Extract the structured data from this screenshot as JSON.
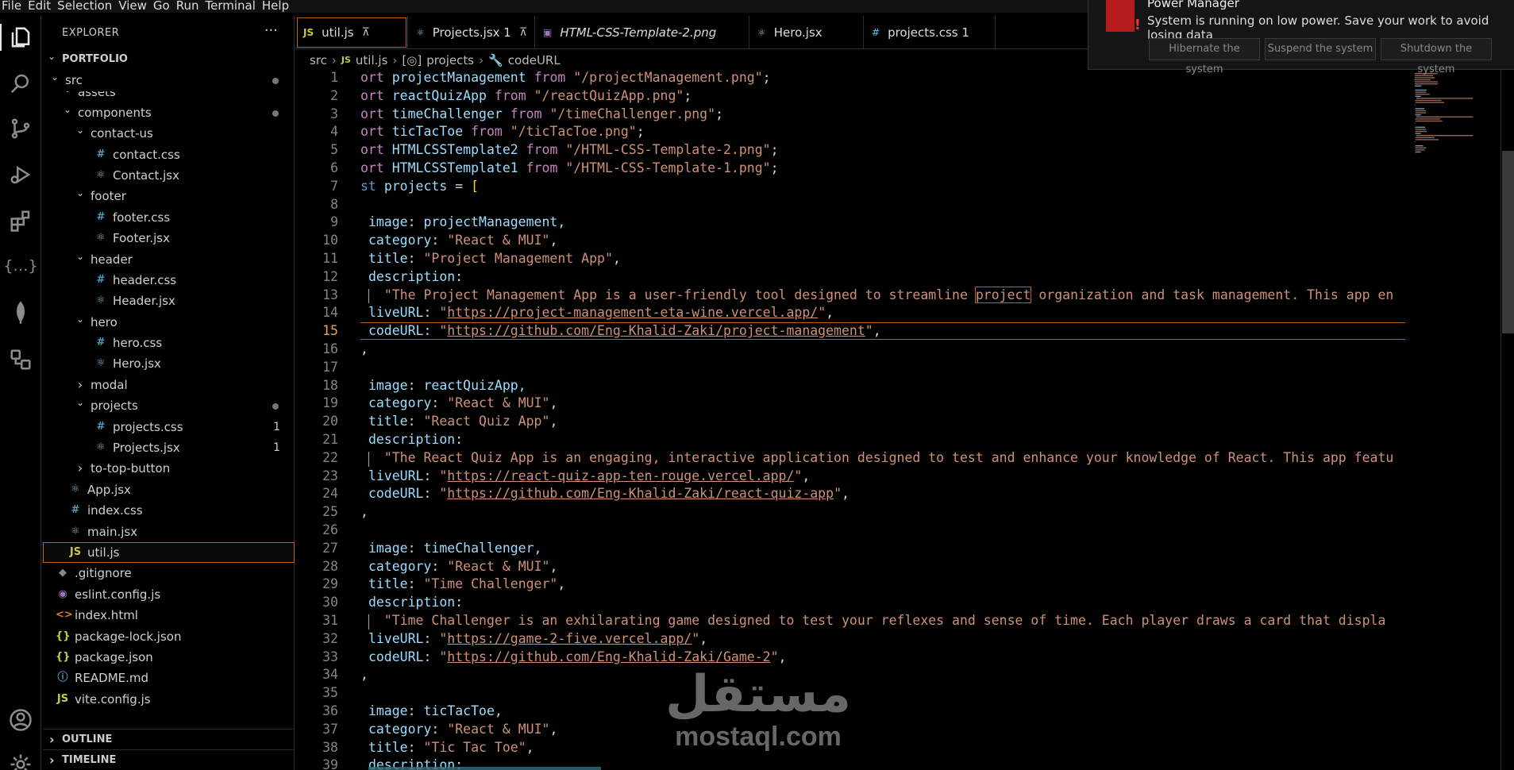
{
  "menu": [
    "File",
    "Edit",
    "Selection",
    "View",
    "Go",
    "Run",
    "Terminal",
    "Help"
  ],
  "activity_bar": [
    {
      "icon": "files-icon",
      "active": true
    },
    {
      "icon": "search-icon"
    },
    {
      "icon": "source-control-icon"
    },
    {
      "icon": "run-debug-icon"
    },
    {
      "icon": "extensions-icon"
    },
    {
      "icon": "json-icon"
    },
    {
      "icon": "mongodb-leaf-icon"
    },
    {
      "icon": "remote-explorer-icon"
    },
    {
      "icon": "account-icon"
    },
    {
      "icon": "settings-gear-icon"
    }
  ],
  "sidebar": {
    "title": "EXPLORER",
    "more": "···",
    "tree": [
      {
        "label": "PORTFOLIO",
        "depth": 0,
        "folder": true,
        "open": true,
        "bold": true
      },
      {
        "label": "src",
        "depth": 1,
        "folder": true,
        "open": true,
        "dot": true
      },
      {
        "label": "assets",
        "depth": 2,
        "folder": true,
        "open": true,
        "clipped": true
      },
      {
        "label": "components",
        "depth": 2,
        "folder": true,
        "open": true,
        "dot": true
      },
      {
        "label": "contact-us",
        "depth": 3,
        "folder": true,
        "open": true
      },
      {
        "label": "contact.css",
        "depth": 4,
        "icon": "#",
        "kind": "css"
      },
      {
        "label": "Contact.jsx",
        "depth": 4,
        "icon": "⚛",
        "kind": "react"
      },
      {
        "label": "footer",
        "depth": 3,
        "folder": true,
        "open": true
      },
      {
        "label": "footer.css",
        "depth": 4,
        "icon": "#",
        "kind": "css"
      },
      {
        "label": "Footer.jsx",
        "depth": 4,
        "icon": "⚛",
        "kind": "react"
      },
      {
        "label": "header",
        "depth": 3,
        "folder": true,
        "open": true
      },
      {
        "label": "header.css",
        "depth": 4,
        "icon": "#",
        "kind": "css"
      },
      {
        "label": "Header.jsx",
        "depth": 4,
        "icon": "⚛",
        "kind": "react"
      },
      {
        "label": "hero",
        "depth": 3,
        "folder": true,
        "open": true
      },
      {
        "label": "hero.css",
        "depth": 4,
        "icon": "#",
        "kind": "css"
      },
      {
        "label": "Hero.jsx",
        "depth": 4,
        "icon": "⚛",
        "kind": "react"
      },
      {
        "label": "modal",
        "depth": 3,
        "folder": true,
        "open": false
      },
      {
        "label": "projects",
        "depth": 3,
        "folder": true,
        "open": true,
        "dot": true
      },
      {
        "label": "projects.css",
        "depth": 4,
        "icon": "#",
        "kind": "css",
        "count": "1"
      },
      {
        "label": "Projects.jsx",
        "depth": 4,
        "icon": "⚛",
        "kind": "react",
        "count": "1"
      },
      {
        "label": "to-top-button",
        "depth": 3,
        "folder": true,
        "open": false
      },
      {
        "label": "App.jsx",
        "depth": 2,
        "icon": "⚛",
        "kind": "react"
      },
      {
        "label": "index.css",
        "depth": 2,
        "icon": "#",
        "kind": "css"
      },
      {
        "label": "main.jsx",
        "depth": 2,
        "icon": "⚛",
        "kind": "react"
      },
      {
        "label": "util.js",
        "depth": 2,
        "icon": "JS",
        "kind": "js",
        "selected": true
      },
      {
        "label": ".gitignore",
        "depth": 1,
        "icon": "◆",
        "kind": "git"
      },
      {
        "label": "eslint.config.js",
        "depth": 1,
        "icon": "◉",
        "kind": "eslint"
      },
      {
        "label": "index.html",
        "depth": 1,
        "icon": "<>",
        "kind": "html"
      },
      {
        "label": "package-lock.json",
        "depth": 1,
        "icon": "{}",
        "kind": "json"
      },
      {
        "label": "package.json",
        "depth": 1,
        "icon": "{}",
        "kind": "json"
      },
      {
        "label": "README.md",
        "depth": 1,
        "icon": "ⓘ",
        "kind": "info"
      },
      {
        "label": "vite.config.js",
        "depth": 1,
        "icon": "JS",
        "kind": "js"
      }
    ],
    "panels": [
      "OUTLINE",
      "TIMELINE"
    ]
  },
  "tabs": [
    {
      "label": "util.js",
      "icon": "JS",
      "kind": "js",
      "active": true,
      "pin": "📌"
    },
    {
      "label": "Projects.jsx 1",
      "icon": "⚛",
      "kind": "react",
      "pin": "📌"
    },
    {
      "label": "HTML-CSS-Template-2.png",
      "icon": "▣",
      "kind": "eslint",
      "italic": true
    },
    {
      "label": "Hero.jsx",
      "icon": "⚛",
      "kind": "react"
    },
    {
      "label": "projects.css 1",
      "icon": "#",
      "kind": "css"
    }
  ],
  "breadcrumb": [
    "src",
    "JS",
    "util.js",
    "projects",
    "codeURL"
  ],
  "editor": {
    "current_line": 15,
    "lines": [
      {
        "n": "1",
        "t": "ort projectManagement from \"/projectManagement.png\";"
      },
      {
        "n": "2",
        "t": "ort reactQuizApp from \"/reactQuizApp.png\";"
      },
      {
        "n": "3",
        "t": "ort timeChallenger from \"/timeChallenger.png\";"
      },
      {
        "n": "4",
        "t": "ort ticTacToe from \"/ticTacToe.png\";"
      },
      {
        "n": "5",
        "t": "ort HTMLCSSTemplate2 from \"/HTML-CSS-Template-2.png\";"
      },
      {
        "n": "6",
        "t": "ort HTMLCSSTemplate1 from \"/HTML-CSS-Template-1.png\";"
      },
      {
        "n": "7",
        "t": "st projects = ["
      },
      {
        "n": "8",
        "t": ""
      },
      {
        "n": "9",
        "t": " image: projectManagement,"
      },
      {
        "n": "10",
        "t": " category: \"React & MUI\","
      },
      {
        "n": "11",
        "t": " title: \"Project Management App\","
      },
      {
        "n": "12",
        "t": " description:"
      },
      {
        "n": "13",
        "t": "   \"The Project Management App is a user-friendly tool designed to streamline project organization and task management. This app en"
      },
      {
        "n": "14",
        "t": " liveURL: \"https://project-management-eta-wine.vercel.app/\","
      },
      {
        "n": "15",
        "t": " codeURL: \"https://github.com/Eng-Khalid-Zaki/project-management\","
      },
      {
        "n": "16",
        "t": ","
      },
      {
        "n": "17",
        "t": ""
      },
      {
        "n": "18",
        "t": " image: reactQuizApp,"
      },
      {
        "n": "19",
        "t": " category: \"React & MUI\","
      },
      {
        "n": "20",
        "t": " title: \"React Quiz App\","
      },
      {
        "n": "21",
        "t": " description:"
      },
      {
        "n": "22",
        "t": "   \"The React Quiz App is an engaging, interactive application designed to test and enhance your knowledge of React. This app featu"
      },
      {
        "n": "23",
        "t": " liveURL: \"https://react-quiz-app-ten-rouge.vercel.app/\","
      },
      {
        "n": "24",
        "t": " codeURL: \"https://github.com/Eng-Khalid-Zaki/react-quiz-app\","
      },
      {
        "n": "25",
        "t": ","
      },
      {
        "n": "26",
        "t": ""
      },
      {
        "n": "27",
        "t": " image: timeChallenger,"
      },
      {
        "n": "28",
        "t": " category: \"React & MUI\","
      },
      {
        "n": "29",
        "t": " title: \"Time Challenger\","
      },
      {
        "n": "30",
        "t": " description:"
      },
      {
        "n": "31",
        "t": "   \"Time Challenger is an exhilarating game designed to test your reflexes and sense of time. Each player draws a card that displa"
      },
      {
        "n": "32",
        "t": " liveURL: \"https://game-2-five.vercel.app/\","
      },
      {
        "n": "33",
        "t": " codeURL: \"https://github.com/Eng-Khalid-Zaki/Game-2\","
      },
      {
        "n": "34",
        "t": ","
      },
      {
        "n": "35",
        "t": ""
      },
      {
        "n": "36",
        "t": " image: ticTacToe,"
      },
      {
        "n": "37",
        "t": " category: \"React & MUI\","
      },
      {
        "n": "38",
        "t": " title: \"Tic Tac Toe\","
      },
      {
        "n": "39",
        "t": " description:"
      }
    ]
  },
  "watermark": {
    "arabic": "مستقل",
    "latin": "mostaql.com"
  },
  "notification": {
    "title": "Power Manager",
    "body": "System is running on low power. Save your work to avoid losing data",
    "buttons": [
      "Hibernate the system",
      "Suspend the system",
      "Shutdown the system"
    ],
    "icon": "battery-warning-icon"
  },
  "colors": {
    "accent": "#b5651d",
    "string": "#ce9178",
    "property": "#9cdcfe",
    "keyword": "#569cd6"
  }
}
